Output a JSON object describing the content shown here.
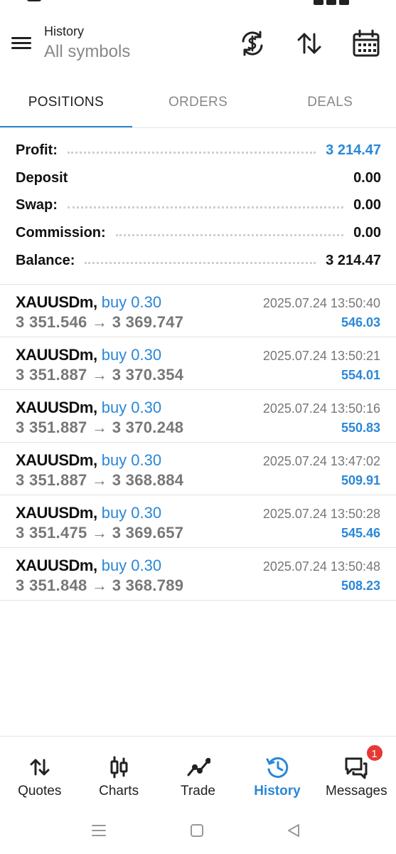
{
  "header": {
    "title": "History",
    "subtitle": "All symbols",
    "icons": [
      "hamburger-menu-icon",
      "exchange-dollar-icon",
      "sort-arrows-icon",
      "calendar-icon"
    ]
  },
  "tabs": [
    {
      "label": "POSITIONS",
      "active": true
    },
    {
      "label": "ORDERS",
      "active": false
    },
    {
      "label": "DEALS",
      "active": false
    }
  ],
  "summary": {
    "profit_label": "Profit:",
    "profit_value": "3 214.47",
    "deposit_label": "Deposit",
    "deposit_value": "0.00",
    "swap_label": "Swap:",
    "swap_value": "0.00",
    "commission_label": "Commission:",
    "commission_value": "0.00",
    "balance_label": "Balance:",
    "balance_value": "3 214.47"
  },
  "trades": [
    {
      "symbol": "XAUUSDm,",
      "side": "buy 0.30",
      "open": "3 351.546",
      "close": "3 369.747",
      "arrow": "→",
      "time": "2025.07.24 13:50:40",
      "profit": "546.03"
    },
    {
      "symbol": "XAUUSDm,",
      "side": "buy 0.30",
      "open": "3 351.887",
      "close": "3 370.354",
      "arrow": "→",
      "time": "2025.07.24 13:50:21",
      "profit": "554.01"
    },
    {
      "symbol": "XAUUSDm,",
      "side": "buy 0.30",
      "open": "3 351.887",
      "close": "3 370.248",
      "arrow": "→",
      "time": "2025.07.24 13:50:16",
      "profit": "550.83"
    },
    {
      "symbol": "XAUUSDm,",
      "side": "buy 0.30",
      "open": "3 351.887",
      "close": "3 368.884",
      "arrow": "→",
      "time": "2025.07.24 13:47:02",
      "profit": "509.91"
    },
    {
      "symbol": "XAUUSDm,",
      "side": "buy 0.30",
      "open": "3 351.475",
      "close": "3 369.657",
      "arrow": "→",
      "time": "2025.07.24 13:50:28",
      "profit": "545.46"
    },
    {
      "symbol": "XAUUSDm,",
      "side": "buy 0.30",
      "open": "3 351.848",
      "close": "3 368.789",
      "arrow": "→",
      "time": "2025.07.24 13:50:48",
      "profit": "508.23"
    }
  ],
  "bottom_nav": [
    {
      "label": "Quotes",
      "icon": "quotes-arrows-icon",
      "active": false
    },
    {
      "label": "Charts",
      "icon": "candlestick-icon",
      "active": false
    },
    {
      "label": "Trade",
      "icon": "trade-line-icon",
      "active": false
    },
    {
      "label": "History",
      "icon": "history-clock-icon",
      "active": true
    },
    {
      "label": "Messages",
      "icon": "messages-chat-icon",
      "active": false,
      "badge": "1"
    }
  ],
  "colors": {
    "accent": "#2a87d8",
    "badge": "#e53935",
    "text": "#111111",
    "muted": "#777777"
  }
}
